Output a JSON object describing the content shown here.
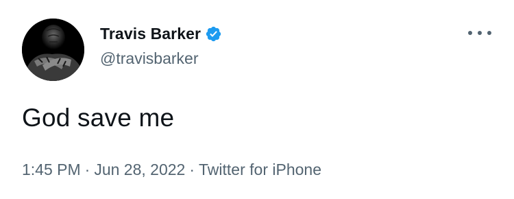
{
  "user": {
    "display_name": "Travis Barker",
    "handle": "@travisbarker",
    "verified": true,
    "verified_icon": "verified-badge-icon",
    "avatar_icon": "avatar"
  },
  "tweet": {
    "text": "God save me",
    "time": "1:45 PM",
    "date": "Jun 28, 2022",
    "source": "Twitter for iPhone",
    "separator": "·"
  },
  "menu": {
    "icon": "more-options-icon"
  },
  "colors": {
    "text_primary": "#0f1419",
    "text_secondary": "#536471",
    "verified_blue": "#1d9bf0",
    "background": "#ffffff"
  }
}
